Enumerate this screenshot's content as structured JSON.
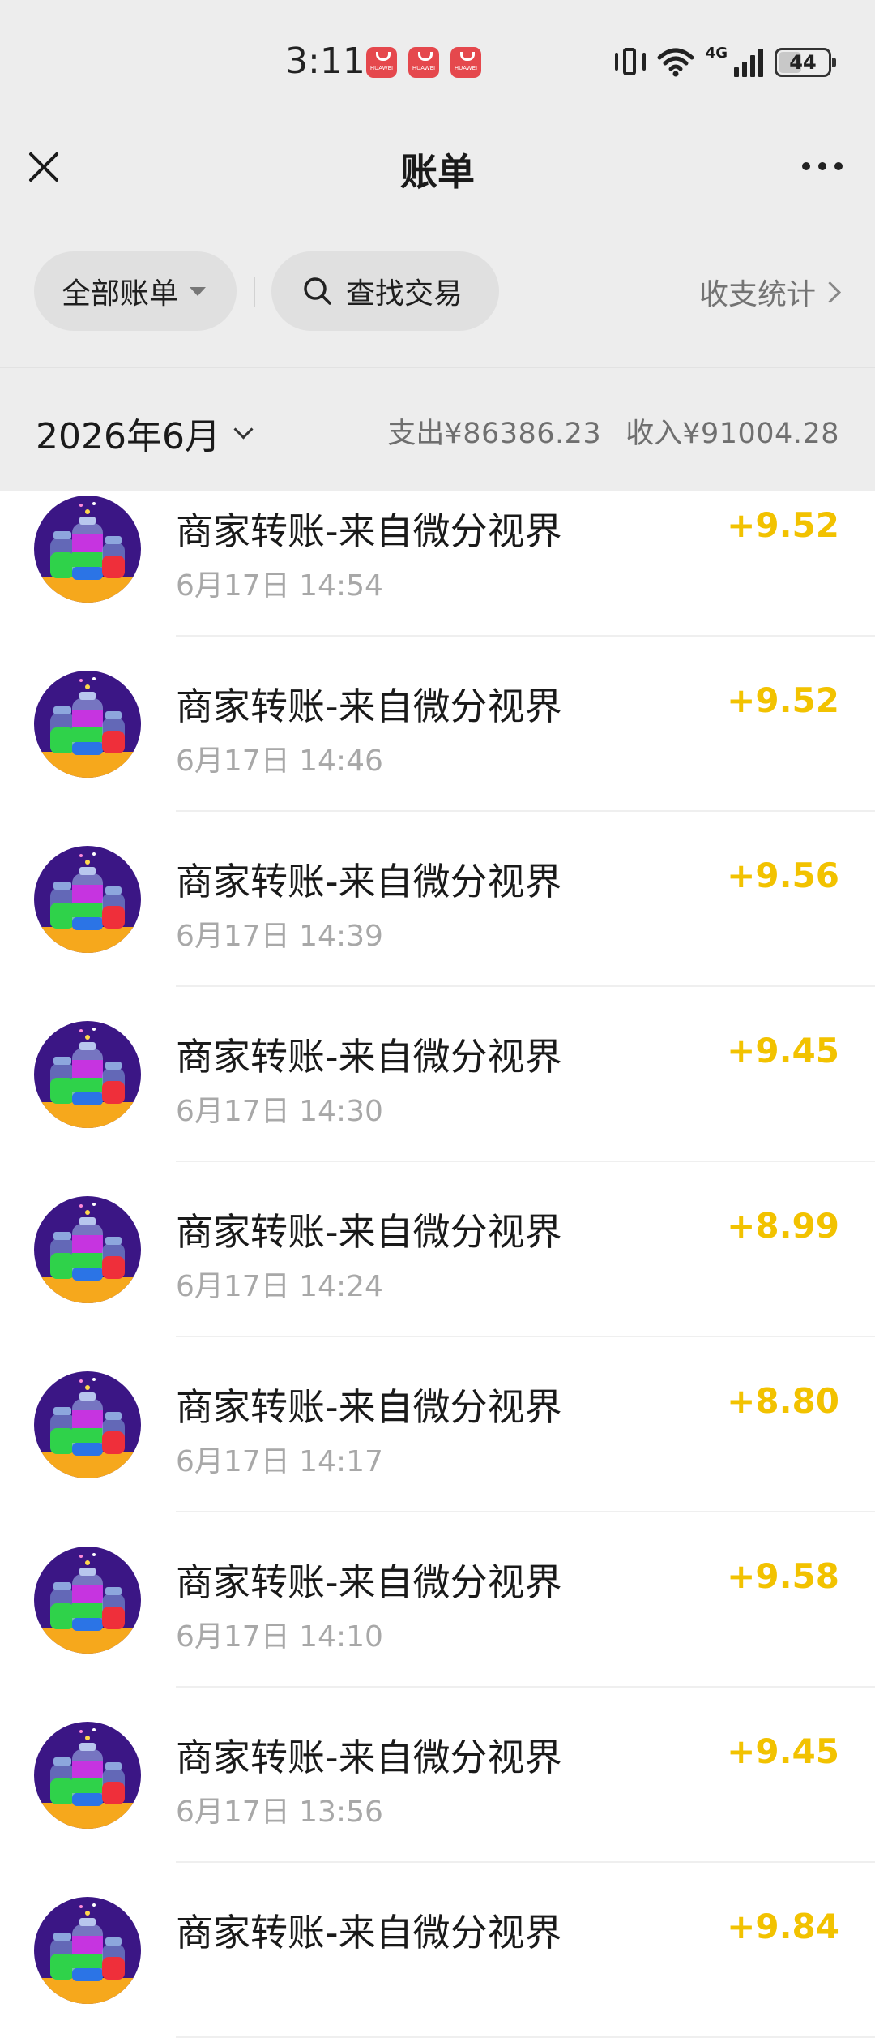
{
  "status_bar": {
    "time": "3:11",
    "notification_icons": [
      "huawei-appgallery-icon",
      "huawei-appgallery-icon",
      "huawei-appgallery-icon"
    ],
    "notification_label": "HUAWEI",
    "network": "4G",
    "battery": "44"
  },
  "nav": {
    "title": "账单",
    "close_icon": "close-icon",
    "more_icon": "more-icon"
  },
  "filters": {
    "all_bills": "全部账单",
    "search": "查找交易",
    "stats": "收支统计"
  },
  "summary": {
    "month": "2026年6月",
    "expense_label": "支出",
    "expense_amount": "¥86386.23",
    "income_label": "收入",
    "income_amount": "¥91004.28"
  },
  "colors": {
    "amount": "#f2c200",
    "header_bg": "#ededed",
    "avatar_bg": "#3b1685"
  },
  "transactions": [
    {
      "title": "商家转账-来自微分视界",
      "time": "6月17日 14:54",
      "amount": "+9.52"
    },
    {
      "title": "商家转账-来自微分视界",
      "time": "6月17日 14:46",
      "amount": "+9.52"
    },
    {
      "title": "商家转账-来自微分视界",
      "time": "6月17日 14:39",
      "amount": "+9.56"
    },
    {
      "title": "商家转账-来自微分视界",
      "time": "6月17日 14:30",
      "amount": "+9.45"
    },
    {
      "title": "商家转账-来自微分视界",
      "time": "6月17日 14:24",
      "amount": "+8.99"
    },
    {
      "title": "商家转账-来自微分视界",
      "time": "6月17日 14:17",
      "amount": "+8.80"
    },
    {
      "title": "商家转账-来自微分视界",
      "time": "6月17日 14:10",
      "amount": "+9.58"
    },
    {
      "title": "商家转账-来自微分视界",
      "time": "6月17日 13:56",
      "amount": "+9.45"
    },
    {
      "title": "商家转账-来自微分视界",
      "time": "",
      "amount": "+9.84"
    }
  ]
}
